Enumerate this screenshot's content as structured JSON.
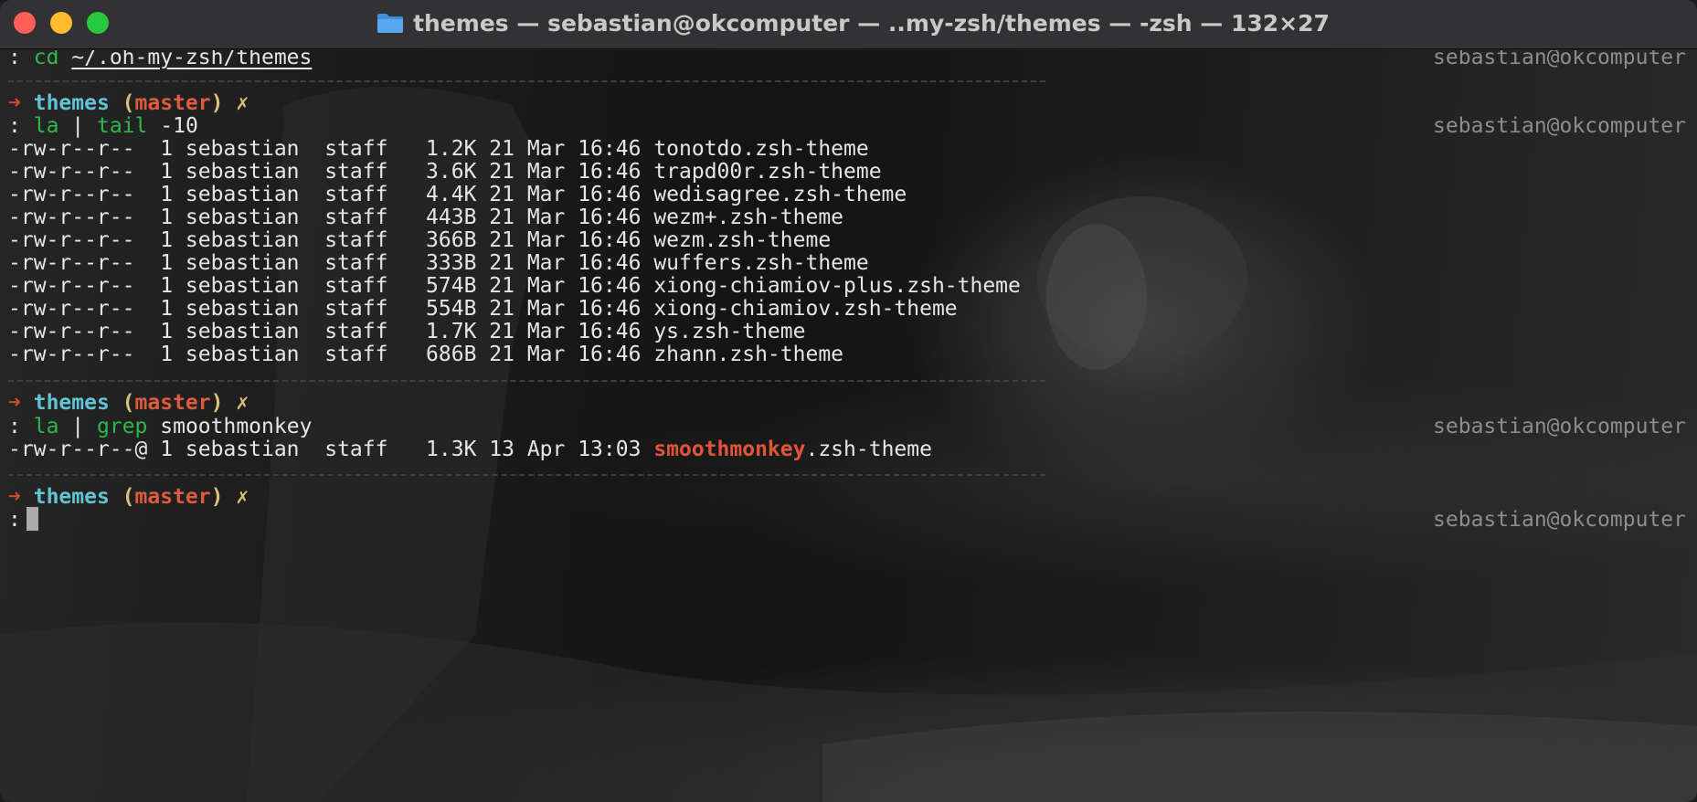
{
  "window": {
    "title": "themes — sebastian@okcomputer — ..my-zsh/themes — -zsh — 132×27",
    "title_icon": "folder-icon"
  },
  "colors": {
    "background": "#1e1e1e",
    "prompt_arrow": "#d24a34",
    "prompt_dir": "#61c3d4",
    "prompt_branch": "#dd5b3e",
    "prompt_paren": "#d9c27a",
    "command": "#2fb84c",
    "highlight": "#e0553a",
    "right_prompt": "#8d8d8d"
  },
  "right_prompt": "sebastian@okcomputer",
  "prompt": {
    "arrow": "➜",
    "dir": "themes",
    "open_paren": "(",
    "branch": "master",
    "close_paren": ")",
    "dirty": "✗",
    "ps2": ":"
  },
  "cmd1": {
    "cmd": "cd",
    "arg": "~/.oh-my-zsh/themes"
  },
  "cmd2": {
    "cmd": "la",
    "pipe": "|",
    "cmd2": "tail",
    "arg": "-10"
  },
  "listing": [
    {
      "perms": "-rw-r--r--",
      "links": "1",
      "owner": "sebastian",
      "group": "staff",
      "size": "1.2K",
      "date": "21 Mar 16:46",
      "name": "tonotdo.zsh-theme"
    },
    {
      "perms": "-rw-r--r--",
      "links": "1",
      "owner": "sebastian",
      "group": "staff",
      "size": "3.6K",
      "date": "21 Mar 16:46",
      "name": "trapd00r.zsh-theme"
    },
    {
      "perms": "-rw-r--r--",
      "links": "1",
      "owner": "sebastian",
      "group": "staff",
      "size": "4.4K",
      "date": "21 Mar 16:46",
      "name": "wedisagree.zsh-theme"
    },
    {
      "perms": "-rw-r--r--",
      "links": "1",
      "owner": "sebastian",
      "group": "staff",
      "size": "443B",
      "date": "21 Mar 16:46",
      "name": "wezm+.zsh-theme"
    },
    {
      "perms": "-rw-r--r--",
      "links": "1",
      "owner": "sebastian",
      "group": "staff",
      "size": "366B",
      "date": "21 Mar 16:46",
      "name": "wezm.zsh-theme"
    },
    {
      "perms": "-rw-r--r--",
      "links": "1",
      "owner": "sebastian",
      "group": "staff",
      "size": "333B",
      "date": "21 Mar 16:46",
      "name": "wuffers.zsh-theme"
    },
    {
      "perms": "-rw-r--r--",
      "links": "1",
      "owner": "sebastian",
      "group": "staff",
      "size": "574B",
      "date": "21 Mar 16:46",
      "name": "xiong-chiamiov-plus.zsh-theme"
    },
    {
      "perms": "-rw-r--r--",
      "links": "1",
      "owner": "sebastian",
      "group": "staff",
      "size": "554B",
      "date": "21 Mar 16:46",
      "name": "xiong-chiamiov.zsh-theme"
    },
    {
      "perms": "-rw-r--r--",
      "links": "1",
      "owner": "sebastian",
      "group": "staff",
      "size": "1.7K",
      "date": "21 Mar 16:46",
      "name": "ys.zsh-theme"
    },
    {
      "perms": "-rw-r--r--",
      "links": "1",
      "owner": "sebastian",
      "group": "staff",
      "size": "686B",
      "date": "21 Mar 16:46",
      "name": "zhann.zsh-theme"
    }
  ],
  "cmd3": {
    "cmd": "la",
    "pipe": "|",
    "cmd2": "grep",
    "arg": "smoothmonkey"
  },
  "grep_result": {
    "perms": "-rw-r--r--@",
    "links": "1",
    "owner": "sebastian",
    "group": "staff",
    "size": "1.3K",
    "date": "13 Apr 13:03",
    "name_match": "smoothmonkey",
    "name_rest": ".zsh-theme"
  }
}
